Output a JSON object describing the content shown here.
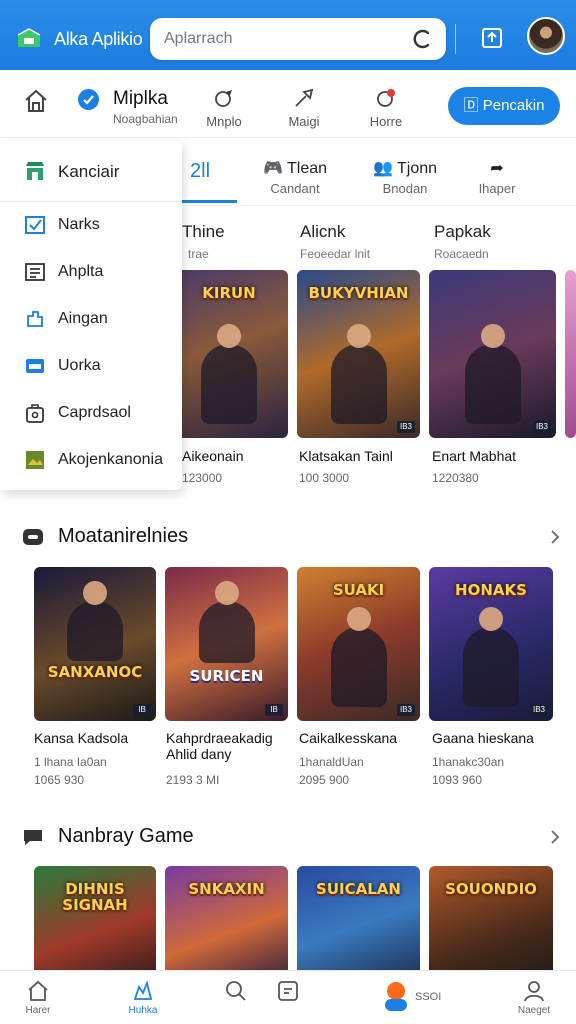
{
  "colors": {
    "primary": "#1b7fe3",
    "topbar": "#2088e6",
    "text": "#111111",
    "muted": "#666666"
  },
  "topbar": {
    "app_title": "Alka Aplikio",
    "search_value": "Aplarrach",
    "icons": [
      "logo-icon",
      "search-icon",
      "share-icon",
      "avatar"
    ]
  },
  "nav2": {
    "title": "Miplka",
    "subtitle": "Noagbahian",
    "items": [
      {
        "label": "Mnplo",
        "icon": "gamepad-icon"
      },
      {
        "label": "Maigi",
        "icon": "sword-icon"
      },
      {
        "label": "Horre",
        "icon": "notification-icon"
      }
    ],
    "action_label": "Pencakin"
  },
  "tabs": {
    "active_label": "2ll",
    "items": [
      {
        "title": "Tlean",
        "sub": "Candant",
        "icon": "controller-icon"
      },
      {
        "title": "Tjonn",
        "sub": "Bnodan",
        "icon": "people-icon"
      },
      {
        "title": "",
        "sub": "Ihaper",
        "icon": "share-arrow-icon"
      }
    ]
  },
  "dropdown": {
    "header": "Kanciair",
    "items": [
      "Narks",
      "Ahplta",
      "Aingan",
      "Uorka",
      "Caprdsaol",
      "Akojenkanonia"
    ]
  },
  "row1": {
    "columns": [
      {
        "title": "Thine",
        "sub": "trae"
      },
      {
        "title": "Alicnk",
        "sub": "Feoeedar lnit"
      },
      {
        "title": "Papkak",
        "sub": "Roacaedn"
      }
    ],
    "cards": [
      {
        "art": "KIRUN",
        "name": "Aikeonain",
        "meta": "123000",
        "badge": ""
      },
      {
        "art": "BUKYVHIAN",
        "name": "Klatsakan Tainl",
        "meta": "100 3000",
        "badge": "IB3"
      },
      {
        "art": "",
        "name": "Enart Mabhat",
        "meta": "1220380",
        "badge": "IB3"
      }
    ]
  },
  "section2": {
    "title": "Moatanirelnies",
    "cards": [
      {
        "art": "SANXANOC",
        "name": "Kansa Kadsola",
        "meta1": "1 lhana Ia0an",
        "meta2": "1065 930",
        "badge": "IB"
      },
      {
        "art": "SURICEN",
        "name": "Kahprdraeakadig Ahlid dany",
        "meta1": "",
        "meta2": "2193 3 MI",
        "badge": "IB"
      },
      {
        "art": "SUAKI",
        "name": "Caikalkesskana",
        "meta1": "1hanaldUan",
        "meta2": "2095 900",
        "badge": "IB3"
      },
      {
        "art": "HONAKS",
        "name": "Gaana hieskana",
        "meta1": "1hanakc30an",
        "meta2": "1093 960",
        "badge": "IB3"
      }
    ]
  },
  "section3": {
    "title": "Nanbray Game",
    "cards": [
      {
        "art": "DIHNIS SIGNAH"
      },
      {
        "art": "SNKAXIN"
      },
      {
        "art": "SUICALAN"
      },
      {
        "art": "SOUONDIO"
      }
    ]
  },
  "bottomnav": {
    "items": [
      {
        "label": "Harer",
        "icon": "home-icon"
      },
      {
        "label": "Huhka",
        "icon": "game-icon",
        "active": true
      },
      {
        "label": "",
        "icon": "search-icon"
      },
      {
        "label": "",
        "icon": "library-icon"
      },
      {
        "label": "",
        "icon": "profile-icon"
      }
    ],
    "center_text": "SSOI",
    "profile_label": "Naeget"
  }
}
